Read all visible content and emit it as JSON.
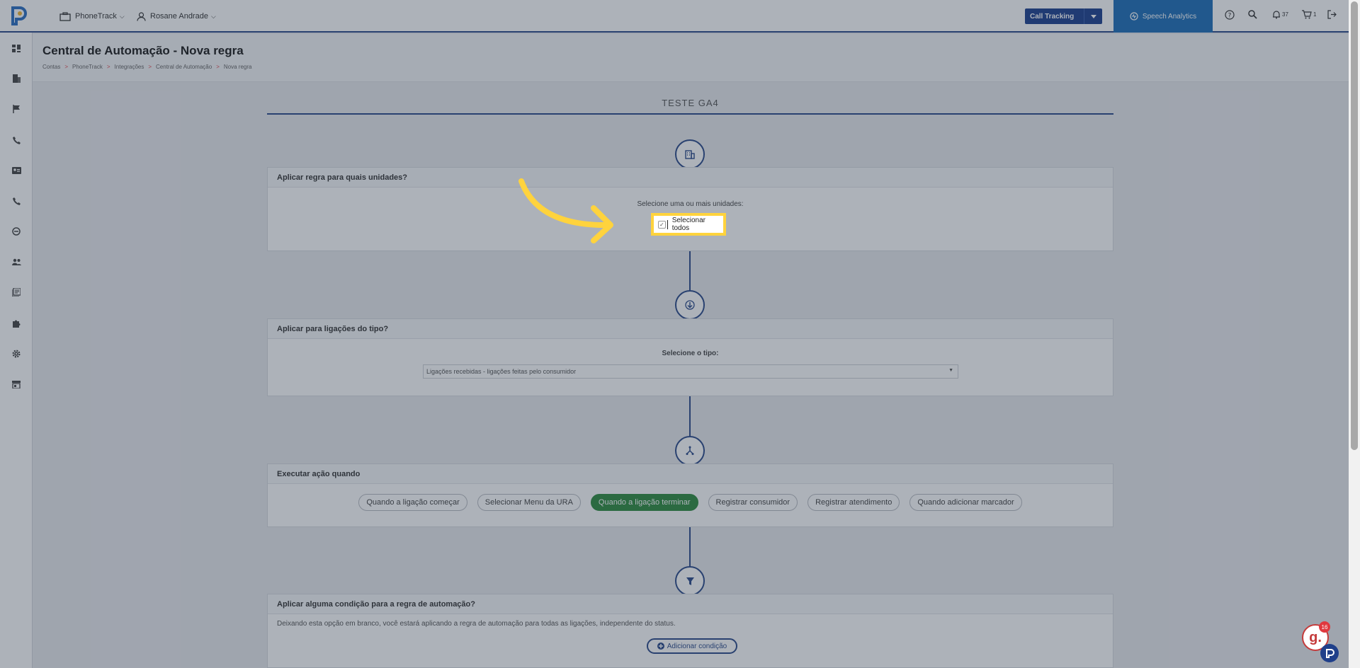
{
  "topbar": {
    "app_menu": "PhoneTrack",
    "user_menu": "Rosane Andrade",
    "call_tracking": "Call Tracking",
    "speech_analytics": "Speech Analytics",
    "notifications_count": "37",
    "cart_count": "1"
  },
  "sidebar": {
    "icons": [
      "dashboard-icon",
      "building-icon",
      "flag-icon",
      "phone-icon",
      "contact-card-icon",
      "phone-forward-icon",
      "minus-circle-icon",
      "users-icon",
      "reports-icon",
      "puzzle-icon",
      "settings-icon",
      "store-icon"
    ]
  },
  "header": {
    "title": "Central de Automação - Nova regra",
    "breadcrumb": [
      "Contas",
      "PhoneTrack",
      "Integrações",
      "Central de Automação",
      "Nova regra"
    ],
    "separator": ">"
  },
  "rule": {
    "name": "TESTE GA4"
  },
  "units_card": {
    "title": "Aplicar regra para quais unidades?",
    "prompt": "Selecione uma ou mais unidades:",
    "select_all": "Selecionar todos"
  },
  "type_card": {
    "title": "Aplicar para ligações do tipo?",
    "prompt": "Selecione o tipo:",
    "selected": "Ligações recebidas - ligações feitas pelo consumidor"
  },
  "trigger_card": {
    "title": "Executar ação quando",
    "options": [
      "Quando a ligação começar",
      "Selecionar Menu da URA",
      "Quando a ligação terminar",
      "Registrar consumidor",
      "Registrar atendimento",
      "Quando adicionar marcador"
    ],
    "active_index": 2
  },
  "condition_card": {
    "title": "Aplicar alguma condição para a regra de automação?",
    "description": "Deixando esta opção em branco, você estará aplicando a regra de automação para todas as ligações, independente do status.",
    "add_button": "Adicionar condição"
  },
  "widget": {
    "badge": "16"
  },
  "colors": {
    "primary": "#2b4a8a",
    "active_green": "#2e8b3e",
    "highlight": "#ffd33d",
    "speech_bg": "#1d6fb8"
  }
}
